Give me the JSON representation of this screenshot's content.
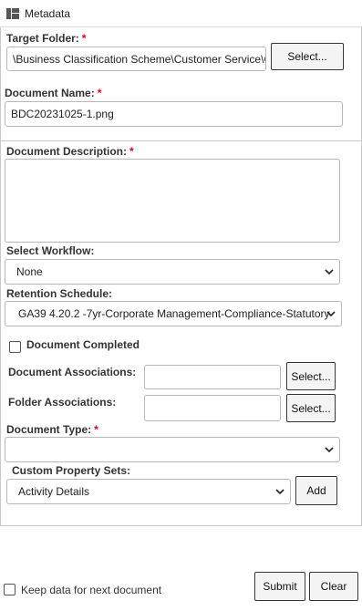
{
  "panel": {
    "title": "Metadata"
  },
  "target_folder": {
    "label": "Target Folder:",
    "value": "\\Business Classification Scheme\\Customer Service\\C",
    "select_label": "Select..."
  },
  "document_name": {
    "label": "Document Name:",
    "value": "BDC20231025-1.png"
  },
  "document_description": {
    "label": "Document Description:",
    "value": ""
  },
  "workflow": {
    "label": "Select Workflow:",
    "selected": "None"
  },
  "retention": {
    "label": "Retention Schedule:",
    "selected": "GA39 4.20.2 -7yr-Corporate Management-Compliance-Statutory"
  },
  "document_completed": {
    "label": "Document Completed",
    "checked": false
  },
  "document_associations": {
    "label": "Document Associations:",
    "value": "",
    "select_label": "Select..."
  },
  "folder_associations": {
    "label": "Folder Associations:",
    "value": "",
    "select_label": "Select..."
  },
  "document_type": {
    "label": "Document Type:",
    "selected": ""
  },
  "custom_property_sets": {
    "label": "Custom Property Sets:",
    "selected": "Activity Details",
    "add_label": "Add"
  },
  "footer": {
    "keep_data_label": "Keep data for next document",
    "keep_data_checked": false,
    "submit_label": "Submit",
    "clear_label": "Clear"
  },
  "required_marker": "*"
}
